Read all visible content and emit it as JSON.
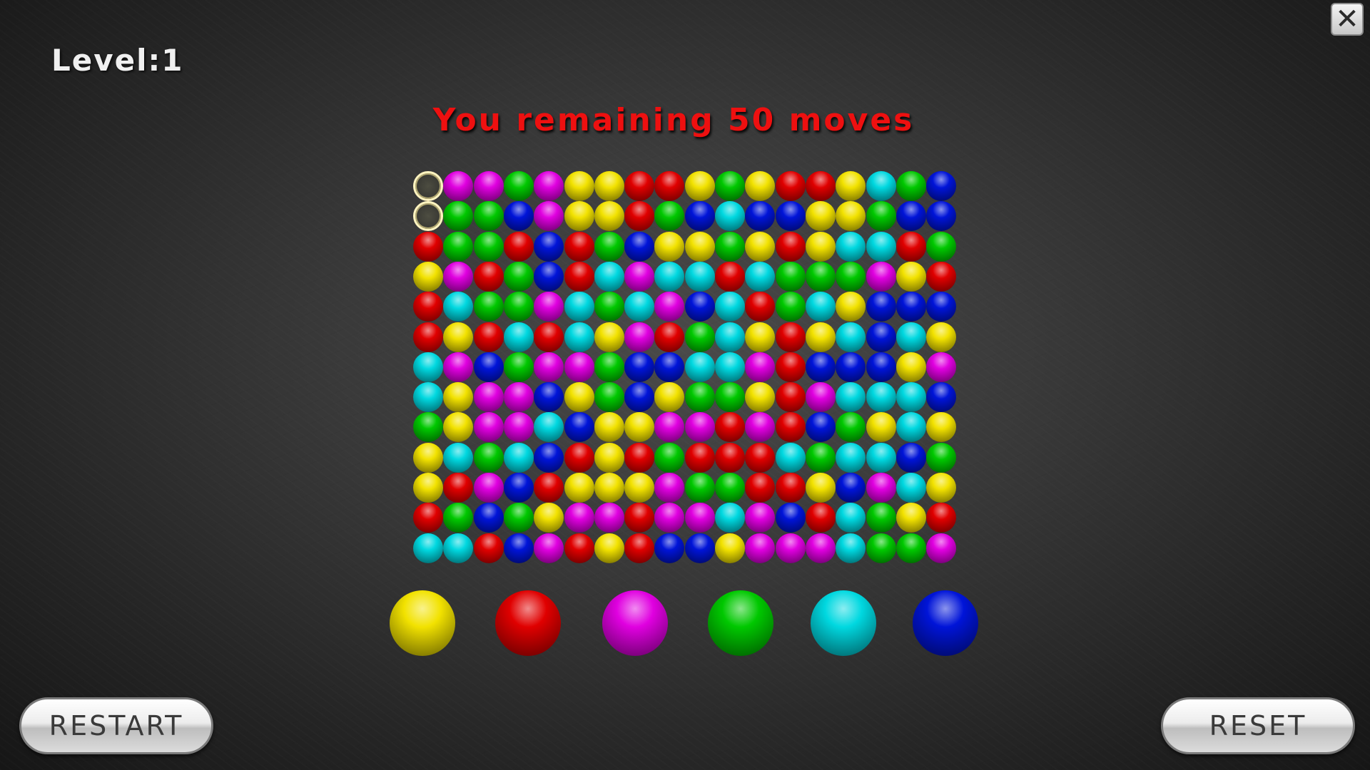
{
  "header": {
    "level_text": "Level:1",
    "moves_text": "You remaining 50 moves",
    "close_icon": "close-icon"
  },
  "colors": {
    "Y": "#f2e200",
    "R": "#e00000",
    "M": "#e000e0",
    "G": "#00c800",
    "C": "#00d8e0",
    "B": "#0014d8"
  },
  "board": {
    "selected_cells": [
      [
        0,
        0
      ],
      [
        1,
        0
      ]
    ],
    "rows": [
      "YMMGMYYRRYGYRRYCGB",
      "YGGBMYYRGBCBBYYGBB",
      "RGGRBRGBYYGYRYCCRG",
      "YMRGBRCMCCRCGGGMYR",
      "RCGGMCGCMBCRGCYBBB",
      "RYRCRCYMRGCYRYCBCY",
      "CMBGMMGBBCCMRBBBYM",
      "CYMMBYGBYGGYRMCCCB",
      "GYMMCBYYMMRMRBGYCY",
      "YCGCBRYRGRRRCGCCBG",
      "YRMBRYYYMGGRRYBMCY",
      "RGBGYMMRMMCMBRCGYR",
      "CCRBMRYRBBYMMMCGGM"
    ]
  },
  "palette": [
    "Y",
    "R",
    "M",
    "G",
    "C",
    "B"
  ],
  "buttons": {
    "restart_label": "RESTART",
    "reset_label": "RESET"
  }
}
